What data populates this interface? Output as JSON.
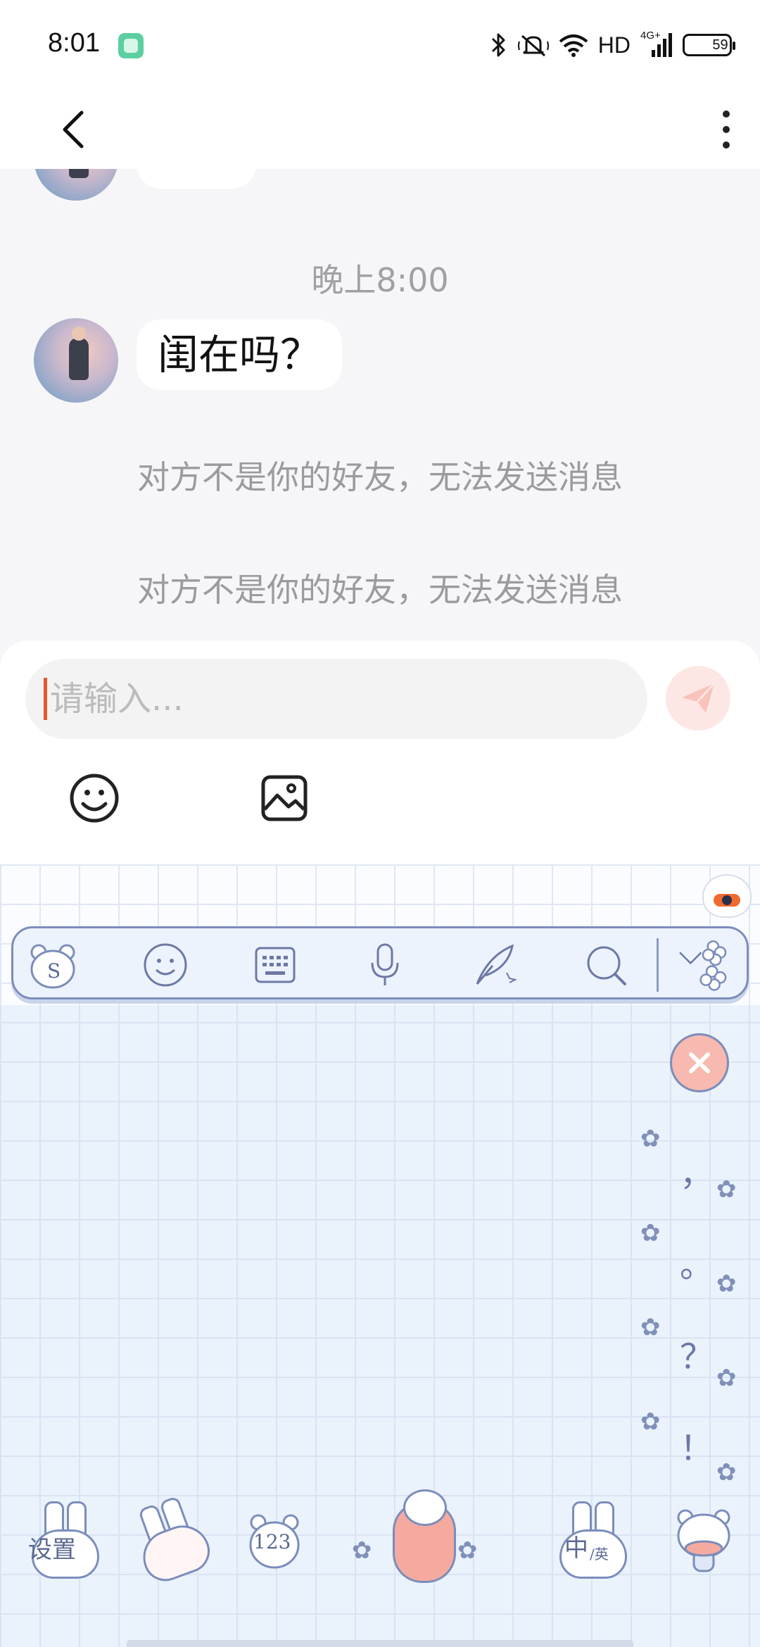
{
  "status_bar": {
    "time": "8:01",
    "network_label": "HD",
    "signal_label": "4G+",
    "battery_level": "59",
    "icons": [
      "app-notification-icon",
      "bluetooth-icon",
      "mute-icon",
      "wifi-icon",
      "signal-icon",
      "battery-icon"
    ]
  },
  "header": {
    "back_icon": "chevron-left-icon",
    "more_icon": "vertical-dots-icon"
  },
  "chat": {
    "timestamp": "晚上8:00",
    "messages": [
      {
        "sender": "other",
        "text": "闺在吗？"
      }
    ],
    "system_messages": [
      "对方不是你的好友，无法发送消息",
      "对方不是你的好友，无法发送消息"
    ]
  },
  "input": {
    "placeholder": "请输入...",
    "value": "",
    "send_icon": "paper-plane-icon",
    "tools": [
      "smiley-icon",
      "image-icon"
    ]
  },
  "keyboard": {
    "toolbar_icons": [
      "bear-logo-icon",
      "emoji-icon",
      "keyboard-icon",
      "microphone-icon",
      "handwriting-icon",
      "search-icon",
      "collapse-icon"
    ],
    "punctuation": [
      "，",
      "。",
      "？",
      "！"
    ],
    "keys": {
      "settings": "设置",
      "numbers": "123",
      "lang_primary": "中",
      "lang_secondary": "/英"
    },
    "accent_color": "#7b8dbb",
    "background_color": "#eaf2fc"
  }
}
